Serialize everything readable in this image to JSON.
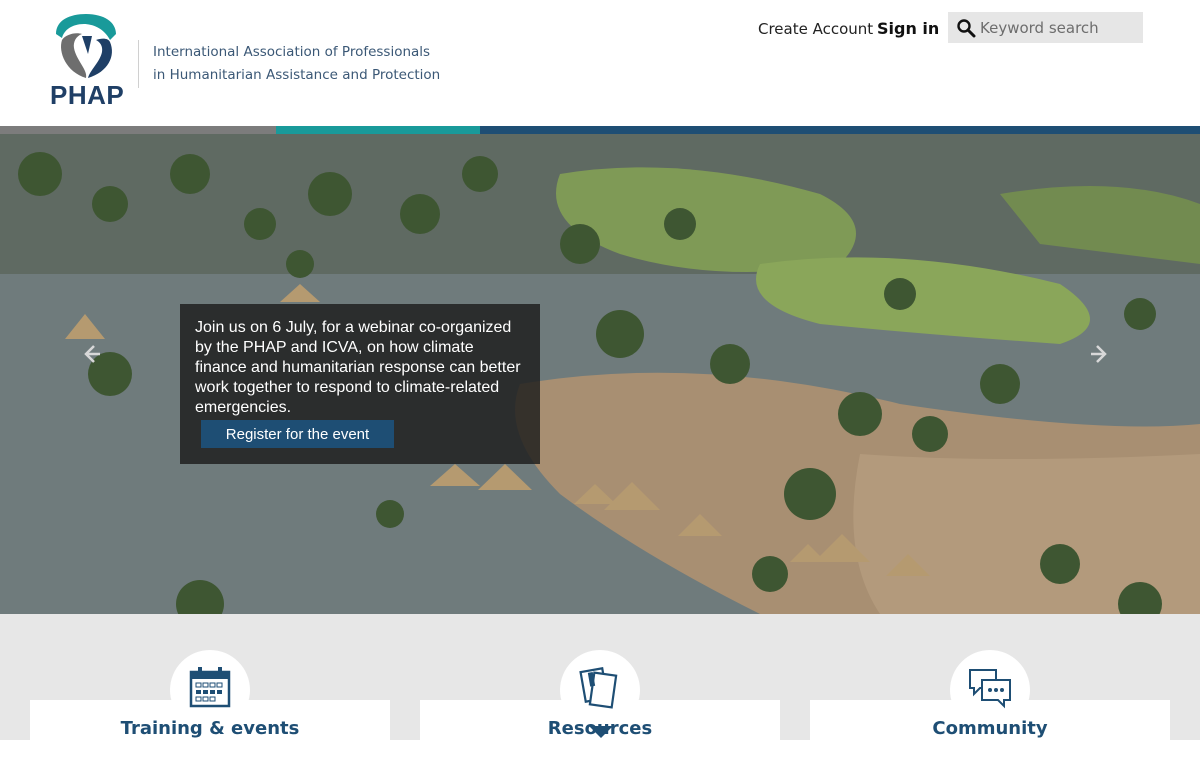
{
  "header": {
    "logo_text": "PHAP",
    "tagline_line1": "International Association of Professionals",
    "tagline_line2": "in Humanitarian Assistance and Protection",
    "create_account": "Create Account",
    "sign_in": "Sign in",
    "search": {
      "placeholder": "Keyword search",
      "value": ""
    }
  },
  "colors": {
    "brand_blue": "#1e4e74",
    "brand_teal": "#199a9a",
    "band_grey": "#7c7c7c"
  },
  "hero": {
    "caption": "Join us on 6 July, for a webinar co-organized by the PHAP and ICVA, on how climate finance and humanitarian response can better work together to respond to climate-related emergencies.",
    "button_label": "Register for the event",
    "prev_icon": "chevron-left-icon",
    "next_icon": "chevron-right-icon"
  },
  "features": [
    {
      "title": "Training & events",
      "icon": "calendar-icon"
    },
    {
      "title": "Resources",
      "icon": "documents-icon"
    },
    {
      "title": "Community",
      "icon": "chat-bubbles-icon"
    }
  ]
}
